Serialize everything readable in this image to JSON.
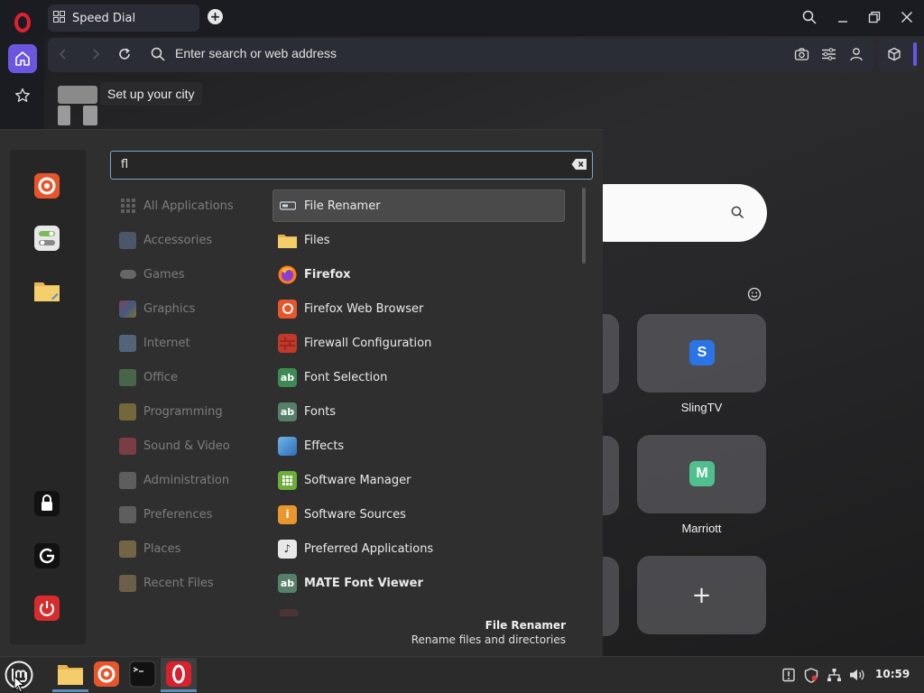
{
  "browser": {
    "tab_title": "Speed Dial",
    "address_placeholder": "Enter search or web address",
    "weather_prompt": "Set up your city"
  },
  "speed_dial": {
    "tiles": [
      {
        "label": "SlingTV",
        "letter": "S",
        "color": "#2a74e8"
      },
      {
        "label": "Marriott",
        "letter": "M",
        "color": "#4fbf8f"
      }
    ],
    "add_symbol": "+"
  },
  "menu": {
    "search_value": "fl",
    "categories": [
      {
        "label": "All Applications",
        "icon": "grid-icon"
      },
      {
        "label": "Accessories",
        "icon": "scissors-icon"
      },
      {
        "label": "Games",
        "icon": "gamepad-icon"
      },
      {
        "label": "Graphics",
        "icon": "graphics-icon"
      },
      {
        "label": "Internet",
        "icon": "cloud-icon"
      },
      {
        "label": "Office",
        "icon": "office-icon"
      },
      {
        "label": "Programming",
        "icon": "programming-icon"
      },
      {
        "label": "Sound & Video",
        "icon": "play-icon"
      },
      {
        "label": "Administration",
        "icon": "admin-icon"
      },
      {
        "label": "Preferences",
        "icon": "preferences-icon"
      },
      {
        "label": "Places",
        "icon": "folder-icon"
      },
      {
        "label": "Recent Files",
        "icon": "recent-folder-icon"
      }
    ],
    "apps": [
      {
        "label": "File Renamer",
        "icon": "renamer-icon",
        "selected": true
      },
      {
        "label": "Files",
        "icon": "folder-icon"
      },
      {
        "label": "Firefox",
        "icon": "firefox-icon",
        "bold": true
      },
      {
        "label": "Firefox Web Browser",
        "icon": "firefox-icon"
      },
      {
        "label": "Firewall Configuration",
        "icon": "firewall-icon"
      },
      {
        "label": "Font Selection",
        "icon": "font-icon"
      },
      {
        "label": "Fonts",
        "icon": "font-icon"
      },
      {
        "label": "Effects",
        "icon": "effects-icon"
      },
      {
        "label": "Software Manager",
        "icon": "software-manager-icon"
      },
      {
        "label": "Software Sources",
        "icon": "software-sources-icon"
      },
      {
        "label": "Preferred Applications",
        "icon": "preferred-apps-icon"
      },
      {
        "label": "MATE Font Viewer",
        "icon": "font-icon",
        "bold": true
      }
    ],
    "description_title": "File Renamer",
    "description_text": "Rename files and directories"
  },
  "taskbar": {
    "clock": "10:59"
  }
}
